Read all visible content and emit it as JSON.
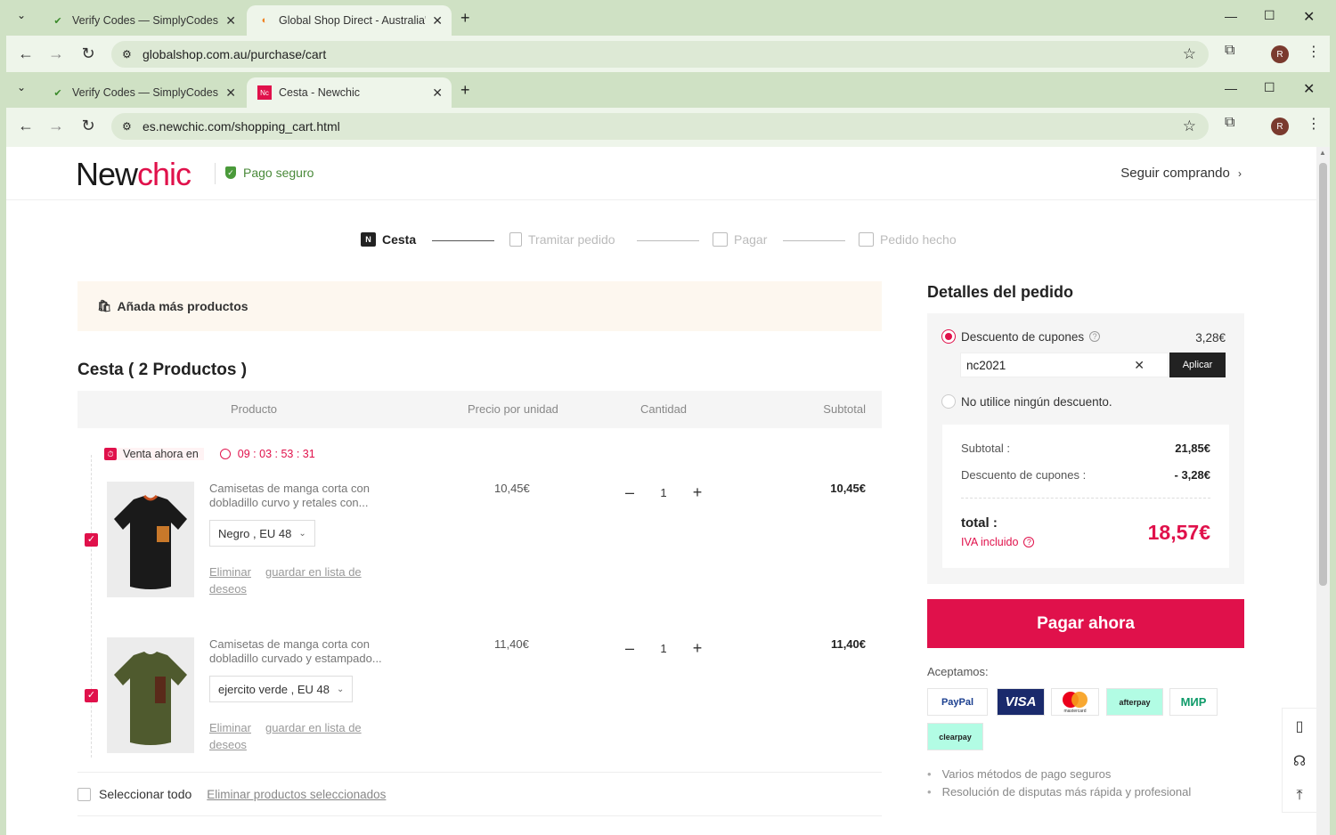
{
  "outer_window": {
    "tabs": [
      {
        "title": "Verify Codes — SimplyCodes"
      },
      {
        "title": "Global Shop Direct - Australia's"
      }
    ],
    "url": "globalshop.com.au/purchase/cart",
    "avatar": "R"
  },
  "inner_window": {
    "tabs": [
      {
        "title": "Verify Codes — SimplyCodes"
      },
      {
        "title": "Cesta - Newchic"
      }
    ],
    "url": "es.newchic.com/shopping_cart.html",
    "avatar": "R"
  },
  "header": {
    "logo_part1": "New",
    "logo_part2": "chic",
    "secure": "Pago seguro",
    "keep_shopping": "Seguir comprando"
  },
  "steps": [
    "Cesta",
    "Tramitar pedido",
    "Pagar",
    "Pedido hecho"
  ],
  "add_more": "Añada más productos",
  "cart_title": "Cesta ( 2 Productos )",
  "table_headers": {
    "product": "Producto",
    "unit_price": "Precio por unidad",
    "qty": "Cantidad",
    "subtotal": "Subtotal"
  },
  "flash_sale": {
    "label": "Venta ahora en",
    "timer": "09 : 03 : 53 : 31"
  },
  "items": [
    {
      "name": "Camisetas de manga corta con dobladillo curvo y retales con...",
      "variant": "Negro , EU 48",
      "remove": "Eliminar",
      "wishlist": "guardar en lista de deseos",
      "unit_price": "10,45€",
      "qty": "1",
      "subtotal": "10,45€"
    },
    {
      "name": "Camisetas de manga corta con dobladillo curvado y estampado...",
      "variant": "ejercito verde , EU 48",
      "remove": "Eliminar",
      "wishlist": "guardar en lista de deseos",
      "unit_price": "11,40€",
      "qty": "1",
      "subtotal": "11,40€"
    }
  ],
  "select_all": "Seleccionar todo",
  "delete_selected": "Eliminar productos seleccionados",
  "order": {
    "title": "Detalles del pedido",
    "coupon_option": "Descuento de cupones",
    "coupon_amount": "3,28€",
    "coupon_code": "nc2021",
    "apply": "Aplicar",
    "no_discount": "No utilice ningún descuento.",
    "subtotal_label": "Subtotal :",
    "subtotal_value": "21,85€",
    "discount_label": "Descuento de cupones :",
    "discount_value": "- 3,28€",
    "total_label": "total :",
    "vat_label": "IVA incluido",
    "total_value": "18,57€",
    "pay_button": "Pagar ahora",
    "accept_label": "Aceptamos:",
    "payment_methods": [
      "PayPal",
      "VISA",
      "mastercard",
      "afterpay",
      "МИР",
      "clearpay"
    ],
    "benefits": [
      "Varios métodos de pago seguros",
      "Resolución de disputas más rápida y profesional"
    ]
  },
  "colors": {
    "brand": "#e0114b",
    "chrome": "#cfe1c4"
  }
}
